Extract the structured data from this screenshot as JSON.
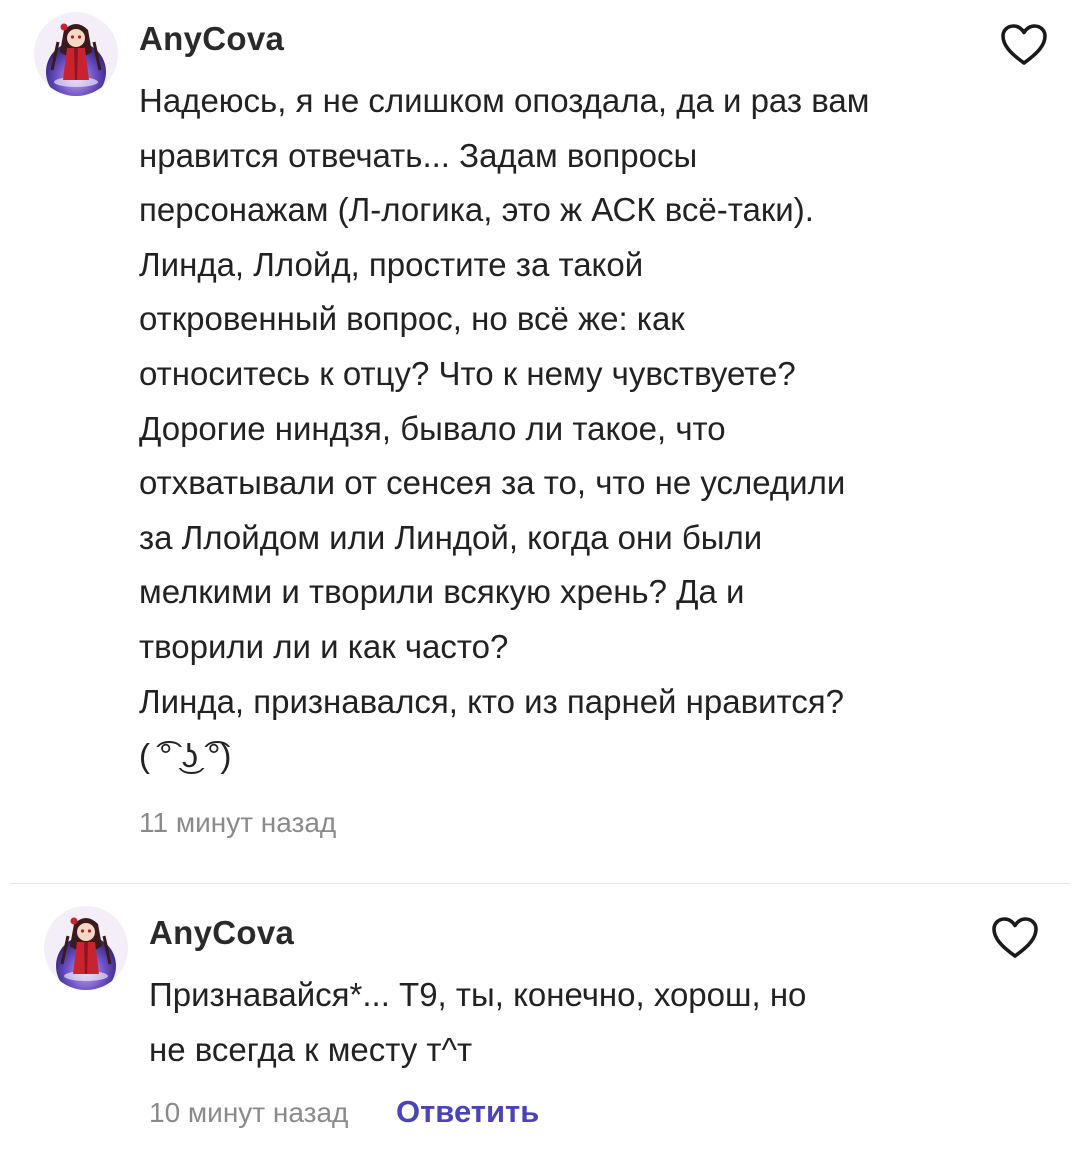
{
  "comments": [
    {
      "username": "AnyCova",
      "body_lines": [
        "Надеюсь, я не слишком опоздала, да и раз вам",
        "нравится отвечать... Задам вопросы",
        "персонажам (Л-логика, это ж АСК всё-таки).",
        "Линда, Ллойд, простите за такой",
        "откровенный вопрос, но всё же: как",
        "относитесь к отцу? Что к нему чувствуете?",
        "Дорогие ниндзя, бывало ли такое, что",
        "отхватывали от сенсея за то, что не уследили",
        "за Ллойдом или Линдой, когда они были",
        "мелкими и творили всякую хрень? Да и",
        "творили ли и как часто?",
        "Линда, признавался, кто из парней нравится?",
        "( ͡° ͜ʖ ͡°)"
      ],
      "timestamp": "11 минут назад",
      "like_icon": "heart-outline-icon"
    },
    {
      "username": "AnyCova",
      "body_lines": [
        "Признавайся*... Т9, ты, конечно, хорош, но",
        "не всегда к месту т^т"
      ],
      "timestamp": "10 минут назад",
      "reply_label": "Ответить",
      "like_icon": "heart-outline-icon"
    }
  ],
  "colors": {
    "accent": "#4b44b8",
    "text": "#222222",
    "muted": "#8a8a8a",
    "divider": "#e6e6e6"
  }
}
